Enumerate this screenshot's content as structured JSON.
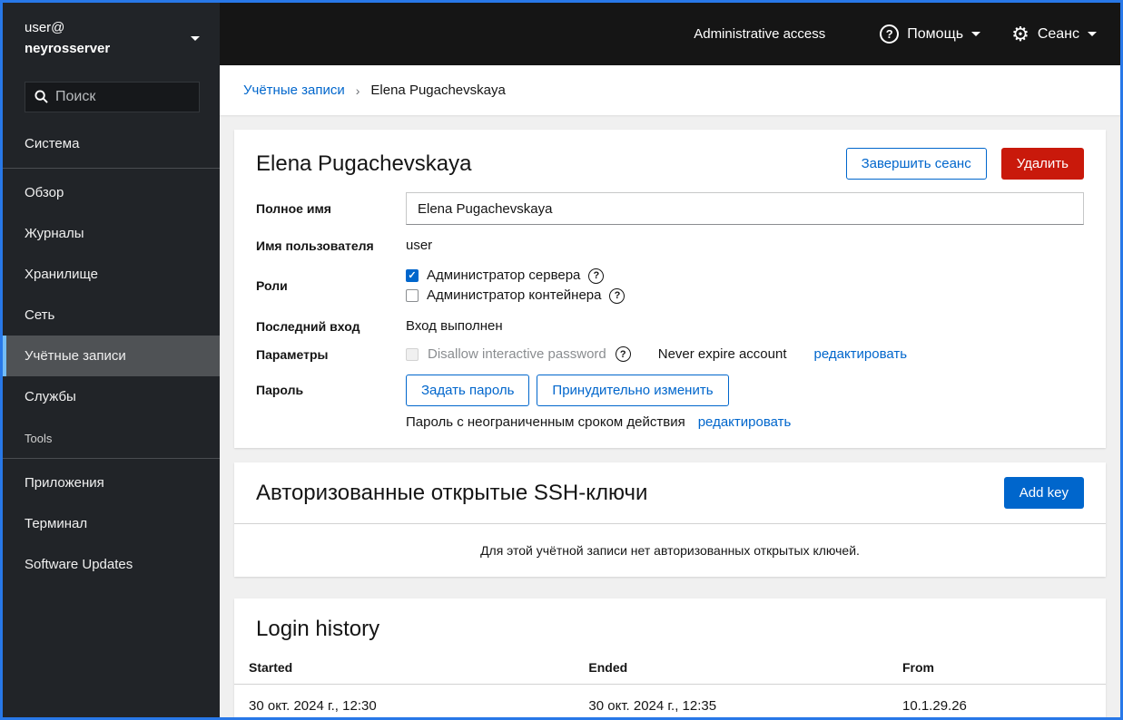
{
  "sidebar": {
    "user": "user@",
    "host": "neyrosserver",
    "search_placeholder": "Поиск",
    "nav": {
      "system": "Система",
      "overview": "Обзор",
      "logs": "Журналы",
      "storage": "Хранилище",
      "network": "Сеть",
      "accounts": "Учётные записи",
      "services": "Службы"
    },
    "tools_section": "Tools",
    "tools": {
      "applications": "Приложения",
      "terminal": "Терминал",
      "software_updates": "Software Updates"
    }
  },
  "masthead": {
    "admin_access": "Administrative access",
    "help": "Помощь",
    "session": "Сеанс"
  },
  "breadcrumb": {
    "parent": "Учётные записи",
    "separator": "›",
    "current": "Elena Pugachevskaya"
  },
  "account": {
    "title": "Elena Pugachevskaya",
    "terminate_button": "Завершить сеанс",
    "delete_button": "Удалить",
    "full_name_label": "Полное имя",
    "full_name_value": "Elena Pugachevskaya",
    "username_label": "Имя пользователя",
    "username_value": "user",
    "roles_label": "Роли",
    "role_server_admin": "Администратор сервера",
    "role_container_admin": "Администратор контейнера",
    "last_login_label": "Последний вход",
    "last_login_value": "Вход выполнен",
    "options_label": "Параметры",
    "disallow_password_label": "Disallow interactive password",
    "never_expire_label": "Never expire account",
    "options_edit_link": "редактировать",
    "password_label": "Пароль",
    "set_password_button": "Задать пароль",
    "force_change_button": "Принудительно изменить",
    "password_expiry_text": "Пароль с неограниченным сроком действия",
    "password_edit_link": "редактировать"
  },
  "ssh": {
    "title": "Авторизованные открытые SSH-ключи",
    "add_key_button": "Add key",
    "empty_text": "Для этой учётной записи нет авторизованных открытых ключей."
  },
  "history": {
    "title": "Login history",
    "columns": [
      "Started",
      "Ended",
      "From"
    ],
    "rows": [
      [
        "30 окт. 2024 г., 12:30",
        "30 окт. 2024 г., 12:35",
        "10.1.29.26"
      ]
    ]
  },
  "colors": {
    "accent_blue": "#0066cc",
    "danger_red": "#c9190b",
    "sidebar_active_accent": "#73bcf7",
    "window_border": "#2878e8",
    "masthead_bg": "#151515",
    "sidebar_bg": "#212428",
    "content_bg": "#f0f0f0"
  }
}
